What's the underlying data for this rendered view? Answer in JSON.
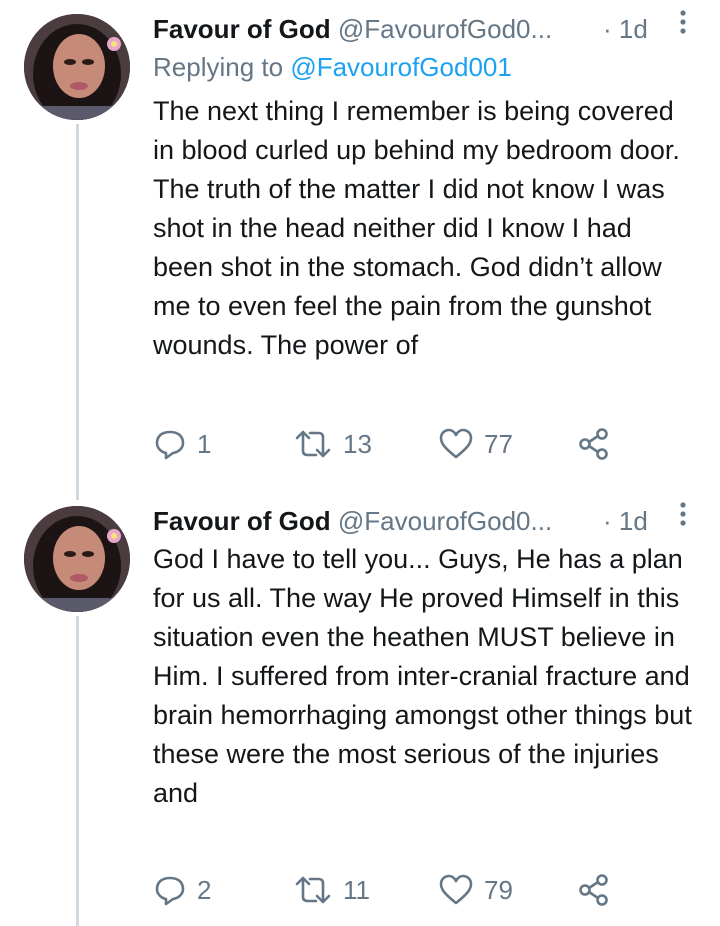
{
  "tweets": [
    {
      "name": "Favour of God",
      "handle": "@FavourofGod0...",
      "time": "· 1d",
      "reply_prefix": "Replying to",
      "reply_handle": "@FavourofGod001",
      "text": "The next thing I remember is being covered in blood curled up behind my bedroom door. The truth of the matter I did not know I was shot in the head neither did I know I had been shot in the stomach. God didn’t allow me to even feel the pain from the gunshot wounds. The power of",
      "replies": "1",
      "retweets": "13",
      "likes": "77"
    },
    {
      "name": "Favour of God",
      "handle": "@FavourofGod0...",
      "time": "· 1d",
      "text": "God I have to tell you... Guys, He has a plan for us all. The way He proved Himself in this situation even the heathen MUST believe in Him. I suffered from inter-cranial fracture and brain hemorrhaging amongst other things but these were the most serious of the injuries and",
      "replies": "2",
      "retweets": "11",
      "likes": "79"
    }
  ],
  "icons": [
    "avatar",
    "more-vertical-icon",
    "reply-icon",
    "retweet-icon",
    "like-icon",
    "share-icon"
  ],
  "colors": {
    "accent": "#1da1f2",
    "muted": "#657786",
    "text": "#14171a",
    "thread_line": "#cfd9de"
  }
}
